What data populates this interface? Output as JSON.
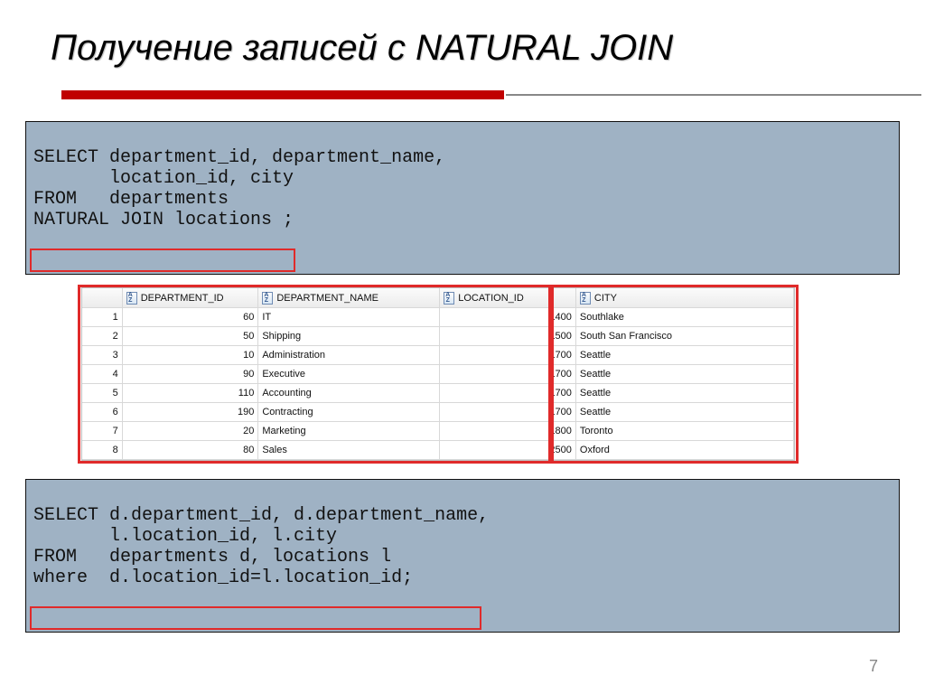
{
  "title": "Получение записей с NATURAL JOIN",
  "page_number": "7",
  "sql1": {
    "line1": "SELECT department_id, department_name,",
    "line2": "       location_id, city",
    "line3": "FROM   departments",
    "line4": "NATURAL JOIN locations ;"
  },
  "sql2": {
    "line1": "SELECT d.department_id, d.department_name,",
    "line2": "       l.location_id, l.city",
    "line3": "FROM   departments d, locations l",
    "line4": "where  d.location_id=l.location_id;"
  },
  "table": {
    "headers": {
      "dept_id": "DEPARTMENT_ID",
      "dept_name": "DEPARTMENT_NAME",
      "loc_id": "LOCATION_ID",
      "city": "CITY"
    },
    "rows": [
      {
        "n": "1",
        "dept_id": "60",
        "dept_name": "IT",
        "loc_id": "1400",
        "city": "Southlake"
      },
      {
        "n": "2",
        "dept_id": "50",
        "dept_name": "Shipping",
        "loc_id": "1500",
        "city": "South San Francisco"
      },
      {
        "n": "3",
        "dept_id": "10",
        "dept_name": "Administration",
        "loc_id": "1700",
        "city": "Seattle"
      },
      {
        "n": "4",
        "dept_id": "90",
        "dept_name": "Executive",
        "loc_id": "1700",
        "city": "Seattle"
      },
      {
        "n": "5",
        "dept_id": "110",
        "dept_name": "Accounting",
        "loc_id": "1700",
        "city": "Seattle"
      },
      {
        "n": "6",
        "dept_id": "190",
        "dept_name": "Contracting",
        "loc_id": "1700",
        "city": "Seattle"
      },
      {
        "n": "7",
        "dept_id": "20",
        "dept_name": "Marketing",
        "loc_id": "1800",
        "city": "Toronto"
      },
      {
        "n": "8",
        "dept_id": "80",
        "dept_name": "Sales",
        "loc_id": "2500",
        "city": "Oxford"
      }
    ]
  }
}
